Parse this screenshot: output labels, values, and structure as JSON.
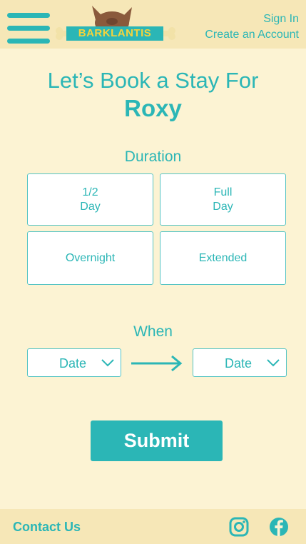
{
  "header": {
    "logo_text": "BARKLANTIS",
    "sign_in": "Sign In",
    "create_account": "Create an Account"
  },
  "main": {
    "title": "Let’s Book a Stay For",
    "pet_name": "Roxy"
  },
  "duration": {
    "label": "Duration",
    "options": [
      {
        "line1": "1/2",
        "line2": "Day"
      },
      {
        "line1": "Full",
        "line2": "Day"
      },
      {
        "line1": "Overnight"
      },
      {
        "line1": "Extended"
      }
    ]
  },
  "when": {
    "label": "When",
    "start_date": "Date",
    "end_date": "Date"
  },
  "submit_label": "Submit",
  "footer": {
    "contact": "Contact Us"
  },
  "colors": {
    "accent": "#2bb6b6",
    "background": "#fcf3d3",
    "bar": "#f6e7b7",
    "logo_text": "#f5d33c",
    "logo_dog": "#8a5a3c"
  },
  "icons": [
    "menu-icon",
    "dog-logo-icon",
    "chevron-down-icon",
    "arrow-right-icon",
    "instagram-icon",
    "facebook-icon"
  ]
}
